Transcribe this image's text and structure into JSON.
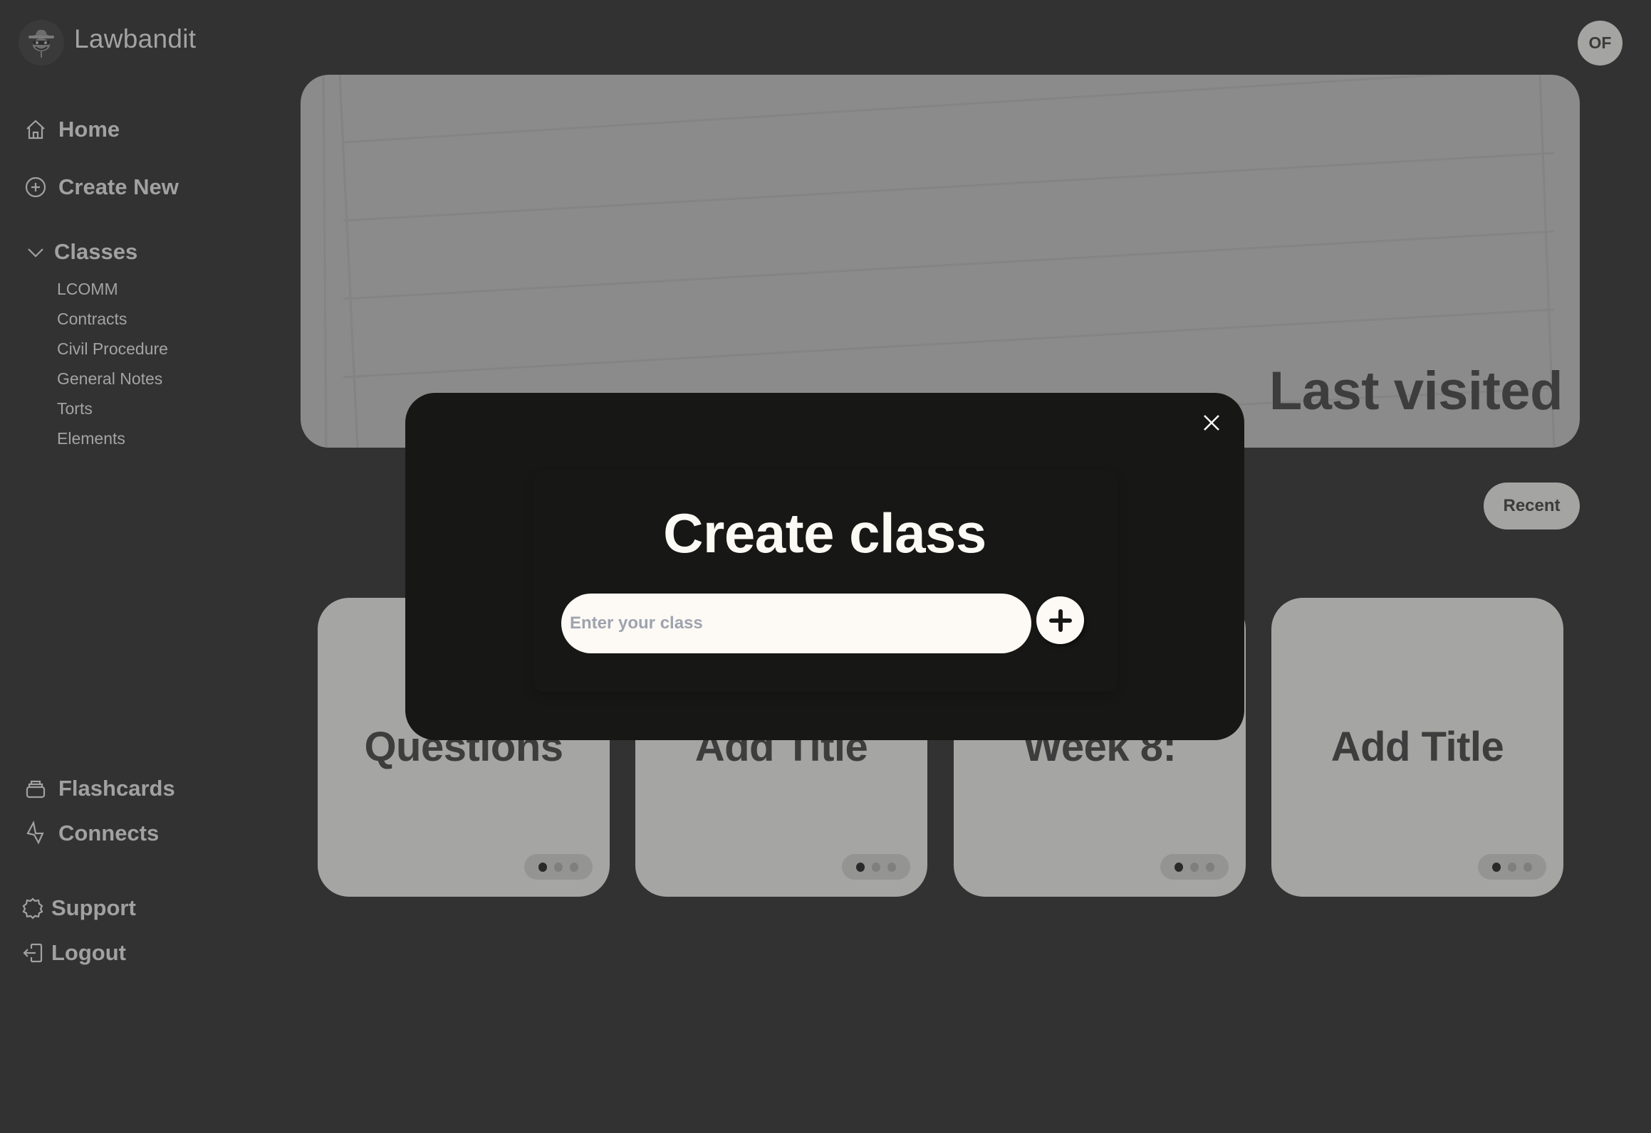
{
  "app": {
    "brand": "Lawbandit",
    "logo_icon": "bandit-logo-icon"
  },
  "user": {
    "initials": "OF"
  },
  "sidebar": {
    "primary": [
      {
        "label": "Home",
        "icon": "home-icon"
      },
      {
        "label": "Create New",
        "icon": "plus-circle-icon"
      }
    ],
    "classes": {
      "label": "Classes",
      "icon": "chevron-down-icon",
      "expanded": true,
      "items": [
        "LCOMM",
        "Contracts",
        "Civil Procedure",
        "General Notes",
        "Torts",
        "Elements"
      ]
    },
    "tools": [
      {
        "label": "Flashcards",
        "icon": "card-stack-icon"
      },
      {
        "label": "Connects",
        "icon": "connects-icon"
      }
    ],
    "footer": [
      {
        "label": "Support",
        "icon": "support-badge-icon"
      },
      {
        "label": "Logout",
        "icon": "logout-icon"
      }
    ]
  },
  "hero": {
    "title": "Last visited"
  },
  "filter": {
    "label": "Recent"
  },
  "cards": [
    {
      "title": "Questions",
      "pages": 3,
      "active_page": 1
    },
    {
      "title": "Add Title",
      "pages": 3,
      "active_page": 1
    },
    {
      "title": "Week 8:",
      "pages": 3,
      "active_page": 1
    },
    {
      "title": "Add Title",
      "pages": 3,
      "active_page": 1
    }
  ],
  "modal": {
    "title": "Create class",
    "input_placeholder": "Enter your class",
    "input_value": "",
    "add_icon": "plus-icon",
    "close_icon": "close-icon"
  },
  "colors": {
    "background": "#323232",
    "modal": "#171715",
    "card": "#a5a5a3",
    "input": "#fdfaf5",
    "placeholder": "#9ea3ae"
  }
}
